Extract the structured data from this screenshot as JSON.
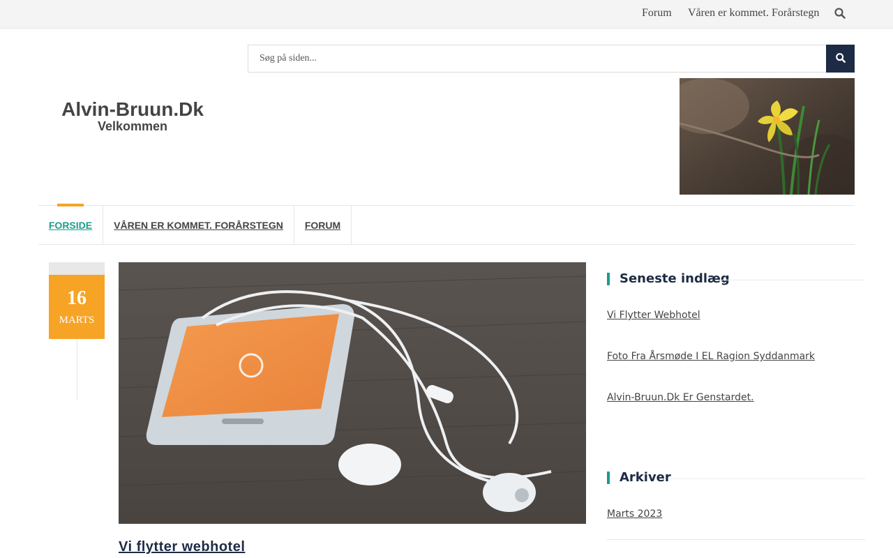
{
  "topbar": {
    "links": [
      "Forum",
      "Våren er kommet. Forårstegn"
    ]
  },
  "search": {
    "placeholder": "Søg på siden..."
  },
  "site": {
    "title": "Alvin-Bruun.Dk",
    "tagline": "Velkommen"
  },
  "nav": {
    "items": [
      "FORSIDE",
      "VÅREN ER KOMMET. FORÅRSTEGN",
      "FORUM"
    ],
    "active": "FORSIDE"
  },
  "post": {
    "date_day": "16",
    "date_month": "MARTS",
    "title": "Vi flytter webhotel"
  },
  "sidebar": {
    "recent_heading": "Seneste indlæg",
    "recent_posts": [
      "Vi Flytter Webhotel",
      "Foto Fra Årsmøde I EL Ragion Syddanmark",
      "Alvin-Bruun.Dk Er Genstardet."
    ],
    "archive_heading": "Arkiver",
    "archives": [
      "Marts 2023"
    ]
  },
  "colors": {
    "accent_orange": "#f7a325",
    "accent_teal": "#1a9c8c",
    "navy": "#1d2b44",
    "topbar_bg": "#f4f4f4"
  },
  "icons": {
    "topbar_search": "search-icon",
    "search_button": "search-icon"
  }
}
